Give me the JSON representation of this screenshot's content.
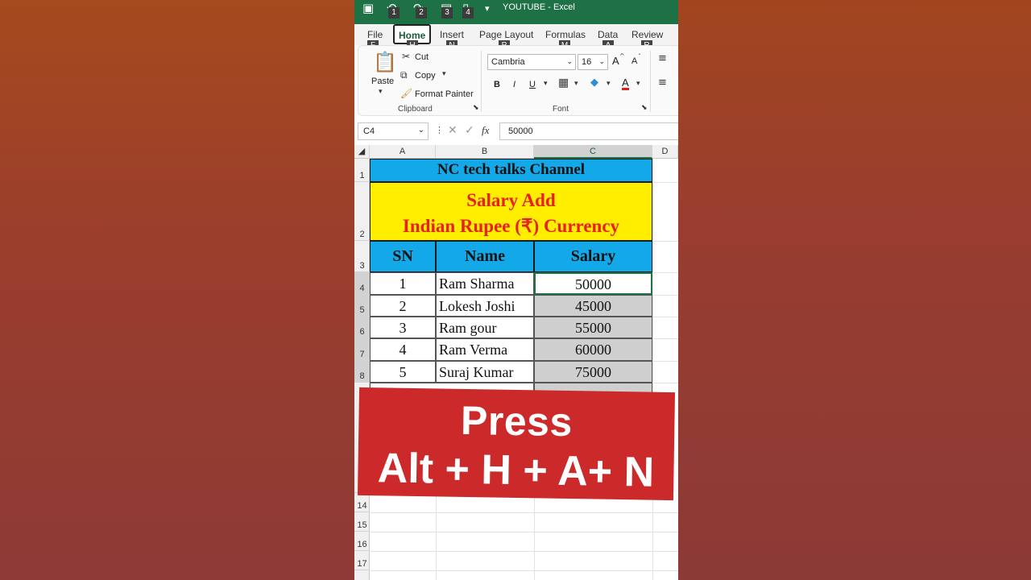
{
  "titlebar": {
    "title": "YOUTUBE  -  Excel",
    "keytips": [
      "1",
      "2",
      "3",
      "4"
    ]
  },
  "tabs": [
    {
      "label": "File",
      "key": "F"
    },
    {
      "label": "Home",
      "key": "H"
    },
    {
      "label": "Insert",
      "key": "N"
    },
    {
      "label": "Page Layout",
      "key": "P"
    },
    {
      "label": "Formulas",
      "key": "M"
    },
    {
      "label": "Data",
      "key": "A"
    },
    {
      "label": "Review",
      "key": "R"
    }
  ],
  "ribbon": {
    "paste_label": "Paste",
    "cut_label": "Cut",
    "copy_label": "Copy",
    "format_painter_label": "Format Painter",
    "clipboard_group": "Clipboard",
    "font_name": "Cambria",
    "font_size": "16",
    "font_group": "Font",
    "bold": "B",
    "italic": "I",
    "underline": "U",
    "grow": "A",
    "shrink": "A",
    "font_color": "A"
  },
  "formula_bar": {
    "name_box": "C4",
    "fx": "fx",
    "value": "50000"
  },
  "columns": [
    "A",
    "B",
    "C",
    "D"
  ],
  "rows": [
    "1",
    "2",
    "3",
    "4",
    "5",
    "6",
    "7",
    "8",
    "14",
    "15",
    "16",
    "17"
  ],
  "sheet": {
    "title": "NC tech talks Channel",
    "subtitle_line1": "Salary Add",
    "subtitle_line2": "Indian Rupee (₹)  Currency",
    "headers": [
      "SN",
      "Name",
      "Salary"
    ],
    "data": [
      {
        "sn": "1",
        "name": "Ram Sharma",
        "salary": "50000"
      },
      {
        "sn": "2",
        "name": "Lokesh Joshi",
        "salary": "45000"
      },
      {
        "sn": "3",
        "name": "Ram gour",
        "salary": "55000"
      },
      {
        "sn": "4",
        "name": "Ram Verma",
        "salary": "60000"
      },
      {
        "sn": "5",
        "name": "Suraj Kumar",
        "salary": "75000"
      }
    ]
  },
  "banner": {
    "line1": "Press",
    "line2": "Alt + H + A+ N",
    "color": "#cc2a2a"
  },
  "colors": {
    "excel_green": "#1e7145",
    "header_blue": "#13a8e8",
    "title_yellow": "#ffee00",
    "subtitle_red": "#e8201e"
  }
}
